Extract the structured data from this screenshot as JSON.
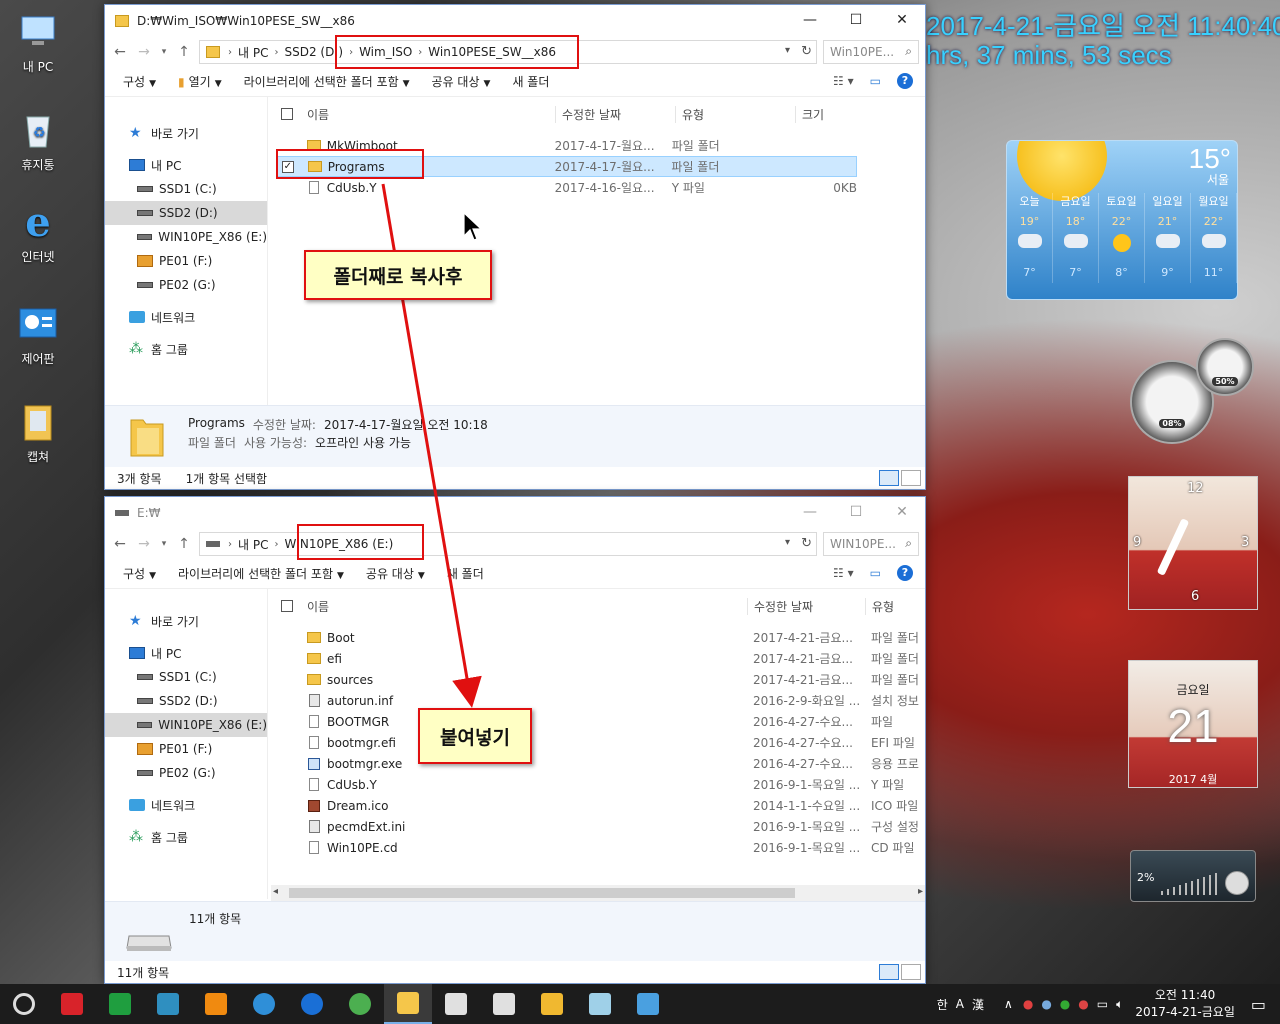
{
  "desktop": {
    "icons": [
      {
        "label": "내 PC",
        "icon": "computer-icon"
      },
      {
        "label": "휴지통",
        "icon": "recycle-bin-icon"
      },
      {
        "label": "인터넷",
        "icon": "internet-explorer-icon"
      },
      {
        "label": "제어판",
        "icon": "control-panel-icon"
      },
      {
        "label": "캡쳐",
        "icon": "folder-icon"
      }
    ],
    "banner_line1": "2017-4-21-금요일 오전 11:40:40",
    "banner_line2": "hrs, 37 mins, 53 secs"
  },
  "window_top": {
    "title": "D:₩Wim_ISO₩Win10PESE_SW__x86",
    "address": [
      "내 PC",
      "SSD2 (D:)",
      "Wim_ISO",
      "Win10PESE_SW__x86"
    ],
    "search_placeholder": "Win10PE...",
    "toolbar": [
      "구성",
      "열기",
      "라이브러리에 선택한 폴더 포함",
      "공유 대상",
      "새 폴더"
    ],
    "columns": [
      "이름",
      "수정한 날짜",
      "유형",
      "크기"
    ],
    "rows": [
      {
        "name": "MkWimboot",
        "date": "2017-4-17-월요...",
        "type": "파일 폴더",
        "size": "",
        "icon": "folder-icon",
        "checked": false
      },
      {
        "name": "Programs",
        "date": "2017-4-17-월요...",
        "type": "파일 폴더",
        "size": "",
        "icon": "folder-icon",
        "checked": true
      },
      {
        "name": "CdUsb.Y",
        "date": "2017-4-16-일요...",
        "type": "Y 파일",
        "size": "0KB",
        "icon": "file-icon",
        "checked": false
      }
    ],
    "details": {
      "name": "Programs",
      "modified_label": "수정한 날짜:",
      "modified_value": "2017-4-17-월요일 오전 10:18",
      "type": "파일 폴더",
      "availability_label": "사용 가능성:",
      "availability_value": "오프라인 사용 가능"
    },
    "status_count": "3개 항목",
    "status_selected": "1개 항목 선택함"
  },
  "window_bottom": {
    "title": "E:₩",
    "address": [
      "내 PC",
      "WIN10PE_X86 (E:)"
    ],
    "search_placeholder": "WIN10PE...",
    "toolbar": [
      "구성",
      "라이브러리에 선택한 폴더 포함",
      "공유 대상",
      "새 폴더"
    ],
    "columns": [
      "이름",
      "수정한 날짜",
      "유형"
    ],
    "rows": [
      {
        "name": "Boot",
        "date": "2017-4-21-금요...",
        "type": "파일 폴더",
        "icon": "folder-icon"
      },
      {
        "name": "efi",
        "date": "2017-4-21-금요...",
        "type": "파일 폴더",
        "icon": "folder-icon"
      },
      {
        "name": "sources",
        "date": "2017-4-21-금요...",
        "type": "파일 폴더",
        "icon": "folder-icon"
      },
      {
        "name": "autorun.inf",
        "date": "2016-2-9-화요일 ...",
        "type": "설치 정보",
        "icon": "settings-file-icon"
      },
      {
        "name": "BOOTMGR",
        "date": "2016-4-27-수요...",
        "type": "파일",
        "icon": "file-icon"
      },
      {
        "name": "bootmgr.efi",
        "date": "2016-4-27-수요...",
        "type": "EFI 파일",
        "icon": "file-icon"
      },
      {
        "name": "bootmgr.exe",
        "date": "2016-4-27-수요...",
        "type": "응용 프로",
        "icon": "exe-icon"
      },
      {
        "name": "CdUsb.Y",
        "date": "2016-9-1-목요일 ...",
        "type": "Y 파일",
        "icon": "file-icon"
      },
      {
        "name": "Dream.ico",
        "date": "2014-1-1-수요일 ...",
        "type": "ICO 파일",
        "icon": "image-icon"
      },
      {
        "name": "pecmdExt.ini",
        "date": "2016-9-1-목요일 ...",
        "type": "구성 설정",
        "icon": "settings-file-icon"
      },
      {
        "name": "Win10PE.cd",
        "date": "2016-9-1-목요일 ...",
        "type": "CD 파일",
        "icon": "file-icon"
      }
    ],
    "details_count": "11개 항목",
    "status_count": "11개 항목"
  },
  "nav_pane": [
    {
      "label": "바로 가기",
      "icon": "star-icon",
      "indent": 0
    },
    {
      "label": "내 PC",
      "icon": "pc-icon",
      "indent": 0
    },
    {
      "label": "SSD1 (C:)",
      "icon": "drive-icon",
      "indent": 1
    },
    {
      "label": "SSD2 (D:)",
      "icon": "drive-icon",
      "indent": 1
    },
    {
      "label": "WIN10PE_X86 (E:)",
      "icon": "drive-icon",
      "indent": 1
    },
    {
      "label": "PE01 (F:)",
      "icon": "pe-drive-icon",
      "indent": 1
    },
    {
      "label": "PE02 (G:)",
      "icon": "drive-icon",
      "indent": 1
    },
    {
      "label": "네트워크",
      "icon": "network-icon",
      "indent": 0
    },
    {
      "label": "홈 그룹",
      "icon": "homegroup-icon",
      "indent": 0
    }
  ],
  "annotations": {
    "copy_note": "폴더째로 복사후",
    "paste_note": "붙여넣기"
  },
  "weather": {
    "temp": "15°",
    "city": "서울",
    "days": [
      {
        "name": "오늘",
        "hi": "19°",
        "lo": "7°",
        "sky": "cloudy"
      },
      {
        "name": "금요일",
        "hi": "18°",
        "lo": "7°",
        "sky": "cloudy"
      },
      {
        "name": "토요일",
        "hi": "22°",
        "lo": "8°",
        "sky": "sunny"
      },
      {
        "name": "일요일",
        "hi": "21°",
        "lo": "9°",
        "sky": "cloudy"
      },
      {
        "name": "월요일",
        "hi": "22°",
        "lo": "11°",
        "sky": "cloudy"
      }
    ]
  },
  "meters": {
    "cpu": "08%",
    "memory": "50%"
  },
  "clock_gadget": {
    "n12": "12",
    "n3": "3",
    "n6": "6",
    "n9": "9"
  },
  "calendar_gadget": {
    "weekday": "금요일",
    "day": "21",
    "month": "2017 4월"
  },
  "volume_gadget": {
    "percent": "2%"
  },
  "taskbar": {
    "ime": [
      "한",
      "A",
      "漢"
    ],
    "time": "오전 11:40",
    "date": "2017-4-21-금요일",
    "apps": [
      {
        "name": "cortana",
        "color": "#555555"
      },
      {
        "name": "app-red",
        "color": "#d8232a"
      },
      {
        "name": "app-green",
        "color": "#1f9e3f"
      },
      {
        "name": "app-teal",
        "color": "#2f8fc0"
      },
      {
        "name": "app-orange",
        "color": "#f08a10"
      },
      {
        "name": "internet-explorer",
        "color": "#2f8fd8"
      },
      {
        "name": "edge",
        "color": "#1a6fd6"
      },
      {
        "name": "chrome",
        "color": "#4caf50"
      },
      {
        "name": "file-explorer",
        "color": "#f5c64a"
      },
      {
        "name": "store",
        "color": "#e0e0e0"
      },
      {
        "name": "mail",
        "color": "#e0e0e0"
      },
      {
        "name": "folder",
        "color": "#f0b830"
      },
      {
        "name": "notes",
        "color": "#9fd0e8"
      },
      {
        "name": "photos",
        "color": "#4aa0e0"
      }
    ]
  }
}
